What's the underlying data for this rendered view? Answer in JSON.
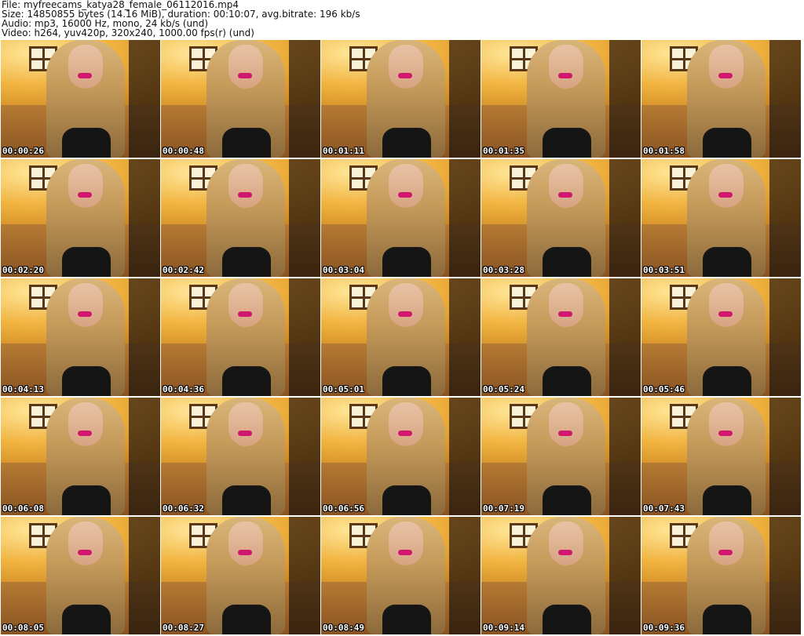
{
  "header": {
    "file_line": "File: myfreecams_katya28_female_06112016.mp4",
    "size_line": "Size: 14850855 bytes (14.16 MiB), duration: 00:10:07, avg.bitrate: 196 kb/s",
    "audio_line": "Audio: mp3, 16000 Hz, mono, 24 kb/s (und)",
    "video_line": "Video: h264, yuv420p, 320x240, 1000.00 fps(r) (und)"
  },
  "thumbnails": [
    {
      "timestamp": "00:00:26"
    },
    {
      "timestamp": "00:00:48"
    },
    {
      "timestamp": "00:01:11"
    },
    {
      "timestamp": "00:01:35"
    },
    {
      "timestamp": "00:01:58"
    },
    {
      "timestamp": "00:02:20"
    },
    {
      "timestamp": "00:02:42"
    },
    {
      "timestamp": "00:03:04"
    },
    {
      "timestamp": "00:03:28"
    },
    {
      "timestamp": "00:03:51"
    },
    {
      "timestamp": "00:04:13"
    },
    {
      "timestamp": "00:04:36"
    },
    {
      "timestamp": "00:05:01"
    },
    {
      "timestamp": "00:05:24"
    },
    {
      "timestamp": "00:05:46"
    },
    {
      "timestamp": "00:06:08"
    },
    {
      "timestamp": "00:06:32"
    },
    {
      "timestamp": "00:06:56"
    },
    {
      "timestamp": "00:07:19"
    },
    {
      "timestamp": "00:07:43"
    },
    {
      "timestamp": "00:08:05"
    },
    {
      "timestamp": "00:08:27"
    },
    {
      "timestamp": "00:08:49"
    },
    {
      "timestamp": "00:09:14"
    },
    {
      "timestamp": "00:09:36"
    }
  ]
}
